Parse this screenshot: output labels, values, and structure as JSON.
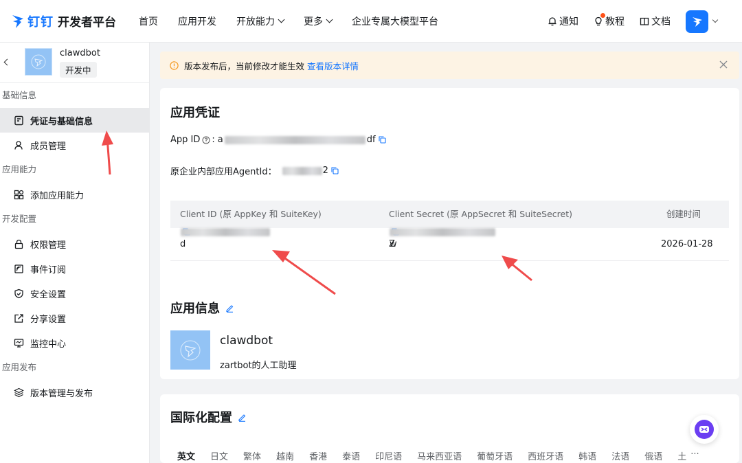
{
  "topnav": {
    "brand": "钉钉",
    "title": "开发者平台",
    "items": [
      {
        "label": "首页",
        "has_dropdown": false
      },
      {
        "label": "应用开发",
        "has_dropdown": false
      },
      {
        "label": "开放能力",
        "has_dropdown": true
      },
      {
        "label": "更多",
        "has_dropdown": true
      },
      {
        "label": "企业专属大模型平台",
        "has_dropdown": false
      }
    ],
    "right": {
      "notify_label": "通知",
      "tutorial_label": "教程",
      "docs_label": "文档"
    }
  },
  "sidebar": {
    "app_name": "clawdbot",
    "app_status": "开发中",
    "sections": [
      {
        "title": "基础信息",
        "items": [
          {
            "label": "凭证与基础信息",
            "icon": "credential-icon",
            "active": true
          },
          {
            "label": "成员管理",
            "icon": "user-icon",
            "active": false
          }
        ]
      },
      {
        "title": "应用能力",
        "items": [
          {
            "label": "添加应用能力",
            "icon": "grid-add-icon",
            "active": false
          }
        ]
      },
      {
        "title": "开发配置",
        "items": [
          {
            "label": "权限管理",
            "icon": "lock-icon",
            "active": false
          },
          {
            "label": "事件订阅",
            "icon": "subscribe-icon",
            "active": false
          },
          {
            "label": "安全设置",
            "icon": "shield-icon",
            "active": false
          },
          {
            "label": "分享设置",
            "icon": "share-icon",
            "active": false
          },
          {
            "label": "监控中心",
            "icon": "monitor-icon",
            "active": false
          }
        ]
      },
      {
        "title": "应用发布",
        "items": [
          {
            "label": "版本管理与发布",
            "icon": "layers-icon",
            "active": false
          }
        ]
      }
    ]
  },
  "notice": {
    "text": "版本发布后，当前修改才能生效",
    "link": "查看版本详情"
  },
  "credentials": {
    "title": "应用凭证",
    "app_id_label": "App ID",
    "app_id_prefix": "a",
    "app_id_suffix": "df",
    "agent_id_label": "原企业内部应用AgentId：",
    "agent_id_suffix": "2",
    "table": {
      "columns": [
        "Client ID (原 AppKey 和 SuiteKey)",
        "Client Secret (原 AppSecret 和 SuiteSecret)",
        "创建时间"
      ],
      "row": {
        "client_id_prefix": "d",
        "client_secret_prefix": "Z",
        "client_secret_suffix": "w",
        "created": "2026-01-28"
      }
    }
  },
  "app_info": {
    "title": "应用信息",
    "name": "clawdbot",
    "description": "zartbot的人工助理"
  },
  "i18n": {
    "title": "国际化配置",
    "tabs": [
      "英文",
      "日文",
      "繁体",
      "越南",
      "香港",
      "泰语",
      "印尼语",
      "马来西亚语",
      "葡萄牙语",
      "西班牙语",
      "韩语",
      "法语",
      "俄语",
      "土"
    ],
    "more": "···"
  },
  "colors": {
    "accent": "#1677ff",
    "annotation_arrow": "#ef4b4b",
    "notice_bg": "#fdf3e4"
  }
}
